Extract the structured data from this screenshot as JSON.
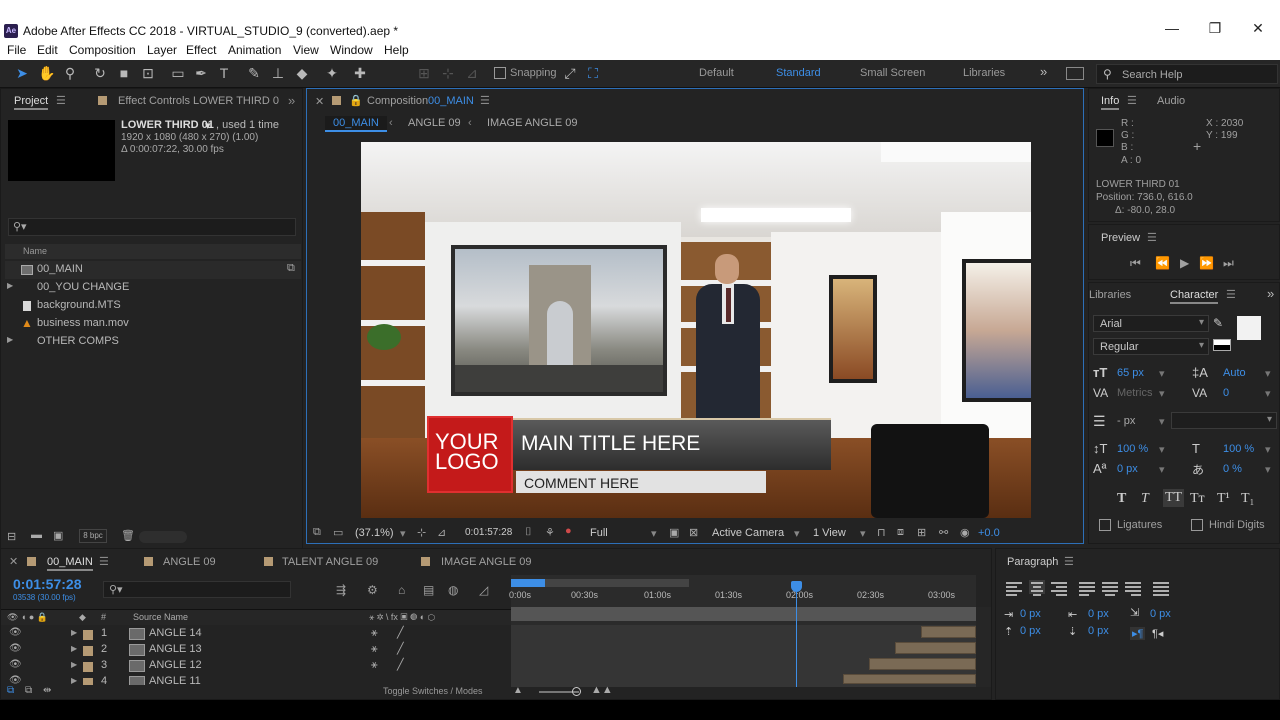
{
  "window": {
    "app_icon": "Ae",
    "title": "Adobe After Effects CC 2018 - VIRTUAL_STUDIO_9 (converted).aep *"
  },
  "menu": [
    "File",
    "Edit",
    "Composition",
    "Layer",
    "Effect",
    "Animation",
    "View",
    "Window",
    "Help"
  ],
  "toolbar": {
    "snapping_label": "Snapping",
    "workspaces": [
      "Default",
      "Standard",
      "Small Screen",
      "Libraries"
    ],
    "active_workspace": "Standard",
    "search_placeholder": "Search Help"
  },
  "project": {
    "tab_project": "Project",
    "tab_effects": "Effect Controls LOWER THIRD 0",
    "selected_name": "LOWER THIRD 01",
    "used_text": ", used 1 time",
    "dims": "1920 x 1080  (480 x 270) (1.00)",
    "duration": "Δ 0:00:07:22, 30.00 fps",
    "col_name": "Name",
    "items": [
      {
        "name": "00_MAIN",
        "type": "comp"
      },
      {
        "name": "00_YOU CHANGE",
        "type": "folder"
      },
      {
        "name": "background.MTS",
        "type": "file"
      },
      {
        "name": "business man.mov",
        "type": "video"
      },
      {
        "name": "OTHER COMPS",
        "type": "folder"
      }
    ],
    "bpc": "8 bpc"
  },
  "composition": {
    "panel_label": "Composition",
    "comp_name": "00_MAIN",
    "crumbs": [
      "00_MAIN",
      "ANGLE 09",
      "IMAGE ANGLE 09"
    ],
    "zoom": "(37.1%)",
    "timecode": "0:01:57:28",
    "resolution": "Full",
    "camera": "Active Camera",
    "views": "1 View",
    "exposure": "+0.0",
    "lower_third": {
      "logo_line1": "YOUR",
      "logo_line2": "LOGO",
      "title": "MAIN TITLE HERE",
      "comment": "COMMENT HERE"
    }
  },
  "info": {
    "tab_info": "Info",
    "tab_audio": "Audio",
    "r": "R :",
    "g": "G :",
    "b": "B :",
    "a": "A : 0",
    "x": "X : 2030",
    "y": "Y : 199",
    "layer": "LOWER THIRD 01",
    "position": "Position: 736.0, 616.0",
    "delta": "Δ: -80.0, 28.0"
  },
  "preview": {
    "label": "Preview"
  },
  "character": {
    "tab_libraries": "Libraries",
    "tab_character": "Character",
    "font": "Arial",
    "style": "Regular",
    "size": "65 px",
    "leading": "Auto",
    "kerning": "Metrics",
    "tracking": "0",
    "stroke": "- px",
    "v_scale": "100 %",
    "h_scale": "100 %",
    "baseline": "0 px",
    "tsume": "0 %",
    "ligatures": "Ligatures",
    "hindi": "Hindi Digits",
    "styles": [
      "T",
      "T",
      "TT",
      "Tт",
      "T¹",
      "T₁"
    ]
  },
  "paragraph": {
    "label": "Paragraph",
    "indent_values": [
      "0 px",
      "0 px",
      "0 px",
      "0 px",
      "0 px"
    ]
  },
  "timeline": {
    "tabs": [
      "00_MAIN",
      "ANGLE 09",
      "TALENT ANGLE 09",
      "IMAGE ANGLE 09"
    ],
    "timecode": "0:01:57:28",
    "frames": "03538 (30.00 fps)",
    "col_source": "Source Name",
    "col_num": "#",
    "ruler": [
      "0:00s",
      "00:30s",
      "01:00s",
      "01:30s",
      "02:00s",
      "02:30s",
      "03:00s"
    ],
    "layers": [
      {
        "num": "1",
        "name": "ANGLE 14"
      },
      {
        "num": "2",
        "name": "ANGLE 13"
      },
      {
        "num": "3",
        "name": "ANGLE 12"
      },
      {
        "num": "4",
        "name": "ANGLE 11"
      }
    ],
    "toggle_label": "Toggle Switches / Modes"
  },
  "colors": {
    "accent": "#3d8ee6",
    "comp_border": "#2d6fb8",
    "logo_red": "#c41a1a"
  }
}
